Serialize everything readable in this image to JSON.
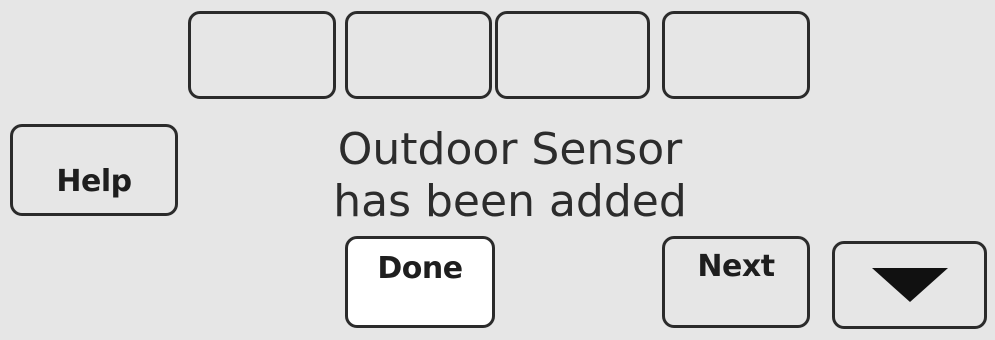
{
  "message": {
    "line1": "Outdoor Sensor",
    "line2": "has been added"
  },
  "buttons": {
    "help_label": "Help",
    "done_label": "Done",
    "next_label": "Next",
    "down_icon": "down-arrow-icon"
  },
  "colors": {
    "screen_bg": "#e6e6e6",
    "border": "#2b2b2b",
    "selected_bg": "#ffffff",
    "text": "#1e1e1e"
  }
}
